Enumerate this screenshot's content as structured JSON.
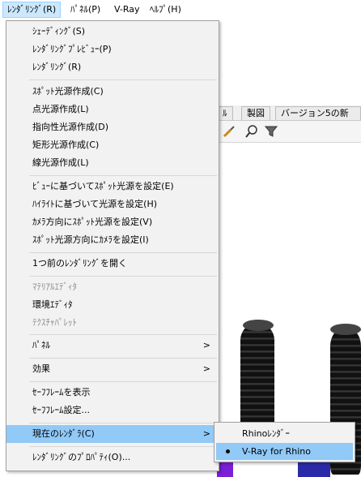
{
  "menubar": {
    "items": [
      "ﾚﾝﾀﾞﾘﾝｸﾞ(R)",
      "ﾊﾟﾈﾙ(P)",
      "V-Ray",
      "ﾍﾙﾌﾟ(H)"
    ]
  },
  "background": {
    "tabs": [
      "ﾙ",
      "製図",
      "バージョン5の新機能"
    ]
  },
  "menu": {
    "items": [
      {
        "label": "ｼｪｰﾃﾞｨﾝｸﾞ(S)"
      },
      {
        "label": "ﾚﾝﾀﾞﾘﾝｸﾞﾌﾟﾚﾋﾞｭｰ(P)"
      },
      {
        "label": "ﾚﾝﾀﾞﾘﾝｸﾞ(R)"
      },
      {
        "label": "ｽﾎﾟｯﾄ光源作成(C)"
      },
      {
        "label": "点光源作成(L)"
      },
      {
        "label": "指向性光源作成(D)"
      },
      {
        "label": "矩形光源作成(C)"
      },
      {
        "label": "線光源作成(L)"
      },
      {
        "label": "ﾋﾞｭｰに基づいてｽﾎﾟｯﾄ光源を設定(E)"
      },
      {
        "label": "ﾊｲﾗｲﾄに基づいて光源を設定(H)"
      },
      {
        "label": "ｶﾒﾗ方向にｽﾎﾟｯﾄ光源を設定(V)"
      },
      {
        "label": "ｽﾎﾟｯﾄ光源方向にｶﾒﾗを設定(I)"
      },
      {
        "label": "1つ前のﾚﾝﾀﾞﾘﾝｸﾞを開く"
      },
      {
        "label": "ﾏﾃﾘｱﾙｴﾃﾞｨﾀ"
      },
      {
        "label": "環境ｴﾃﾞｨﾀ"
      },
      {
        "label": "ﾃｸｽﾁｬﾊﾟﾚｯﾄ"
      },
      {
        "label": "ﾊﾟﾈﾙ"
      },
      {
        "label": "効果"
      },
      {
        "label": "ｾｰﾌﾌﾚｰﾑを表示"
      },
      {
        "label": "ｾｰﾌﾌﾚｰﾑ設定..."
      },
      {
        "label": "現在のﾚﾝﾀﾞﾗ(C)"
      },
      {
        "label": "ﾚﾝﾀﾞﾘﾝｸﾞのﾌﾟﾛﾊﾟﾃｨ(O)..."
      }
    ],
    "submenu_arrow": ">"
  },
  "submenu": {
    "items": [
      {
        "label": "Rhinoﾚﾝﾀﾞｰ"
      },
      {
        "label": "V-Ray for Rhino"
      }
    ]
  },
  "colors": {
    "menu_bg": "#f2f2f2",
    "highlight": "#91c9f7",
    "menubar_active": "#cce8ff",
    "disabled_text": "#8c8c8c"
  }
}
